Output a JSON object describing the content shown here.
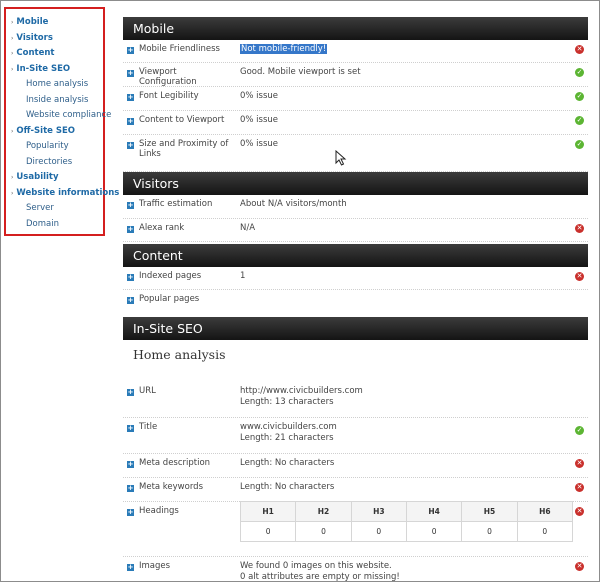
{
  "sidebar": {
    "items": [
      {
        "label": "Mobile",
        "level": 1
      },
      {
        "label": "Visitors",
        "level": 1
      },
      {
        "label": "Content",
        "level": 1
      },
      {
        "label": "In-Site SEO",
        "level": 1
      },
      {
        "label": "Home analysis",
        "level": 2
      },
      {
        "label": "Inside analysis",
        "level": 2
      },
      {
        "label": "Website compliance",
        "level": 2
      },
      {
        "label": "Off-Site SEO",
        "level": 1
      },
      {
        "label": "Popularity",
        "level": 2
      },
      {
        "label": "Directories",
        "level": 2
      },
      {
        "label": "Usability",
        "level": 1
      },
      {
        "label": "Website informations",
        "level": 1
      },
      {
        "label": "Server",
        "level": 2
      },
      {
        "label": "Domain",
        "level": 2
      }
    ]
  },
  "mobile": {
    "title": "Mobile",
    "rows": [
      {
        "label": "Mobile Friendliness",
        "value": "Not mobile-friendly!",
        "status": "fail"
      },
      {
        "label": "Viewport Configuration",
        "value": "Good. Mobile viewport is set",
        "status": "pass"
      },
      {
        "label": "Font Legibility",
        "value": "0% issue",
        "status": "pass"
      },
      {
        "label": "Content to Viewport",
        "value": "0% issue",
        "status": "pass"
      },
      {
        "label": "Size and Proximity of Links",
        "value": "0% issue",
        "status": "pass"
      }
    ]
  },
  "visitors": {
    "title": "Visitors",
    "rows": [
      {
        "label": "Traffic estimation",
        "value": "About N/A visitors/month",
        "status": "none"
      },
      {
        "label": "Alexa rank",
        "value": "N/A",
        "status": "fail"
      }
    ]
  },
  "content": {
    "title": "Content",
    "rows": [
      {
        "label": "Indexed pages",
        "value": "1",
        "status": "fail"
      },
      {
        "label": "Popular pages",
        "value": "",
        "status": "none"
      }
    ]
  },
  "insite": {
    "title": "In-Site SEO",
    "subtitle": "Home analysis",
    "url": {
      "label": "URL",
      "value": "http://www.civicbuilders.com",
      "sub": "Length: 13 characters",
      "status": "none"
    },
    "title_row": {
      "label": "Title",
      "value": "www.civicbuilders.com",
      "sub": "Length: 21 characters",
      "status": "pass"
    },
    "meta_description": {
      "label": "Meta description",
      "value": "Length: No characters",
      "status": "fail"
    },
    "meta_keywords": {
      "label": "Meta keywords",
      "value": "Length: No characters",
      "status": "fail"
    },
    "headings": {
      "label": "Headings",
      "status": "fail",
      "columns": [
        "H1",
        "H2",
        "H3",
        "H4",
        "H5",
        "H6"
      ],
      "counts": [
        "0",
        "0",
        "0",
        "0",
        "0",
        "0"
      ]
    },
    "images": {
      "label": "Images",
      "line1": "We found 0 images on this website.",
      "line2": "0 alt attributes are empty or missing!",
      "status": "fail"
    }
  },
  "icons": {
    "expand": "plus-icon",
    "pass": "check-icon",
    "fail": "cross-icon",
    "nav_arrow": "arrow-right-icon",
    "cursor": "mouse-pointer-icon"
  },
  "colors": {
    "header_bg": "#1e1e1e",
    "pass": "#5cb533",
    "fail": "#c9302c",
    "link": "#1f6aa6",
    "sidebar_border": "#d41f1f",
    "highlight": "#3577c9"
  }
}
